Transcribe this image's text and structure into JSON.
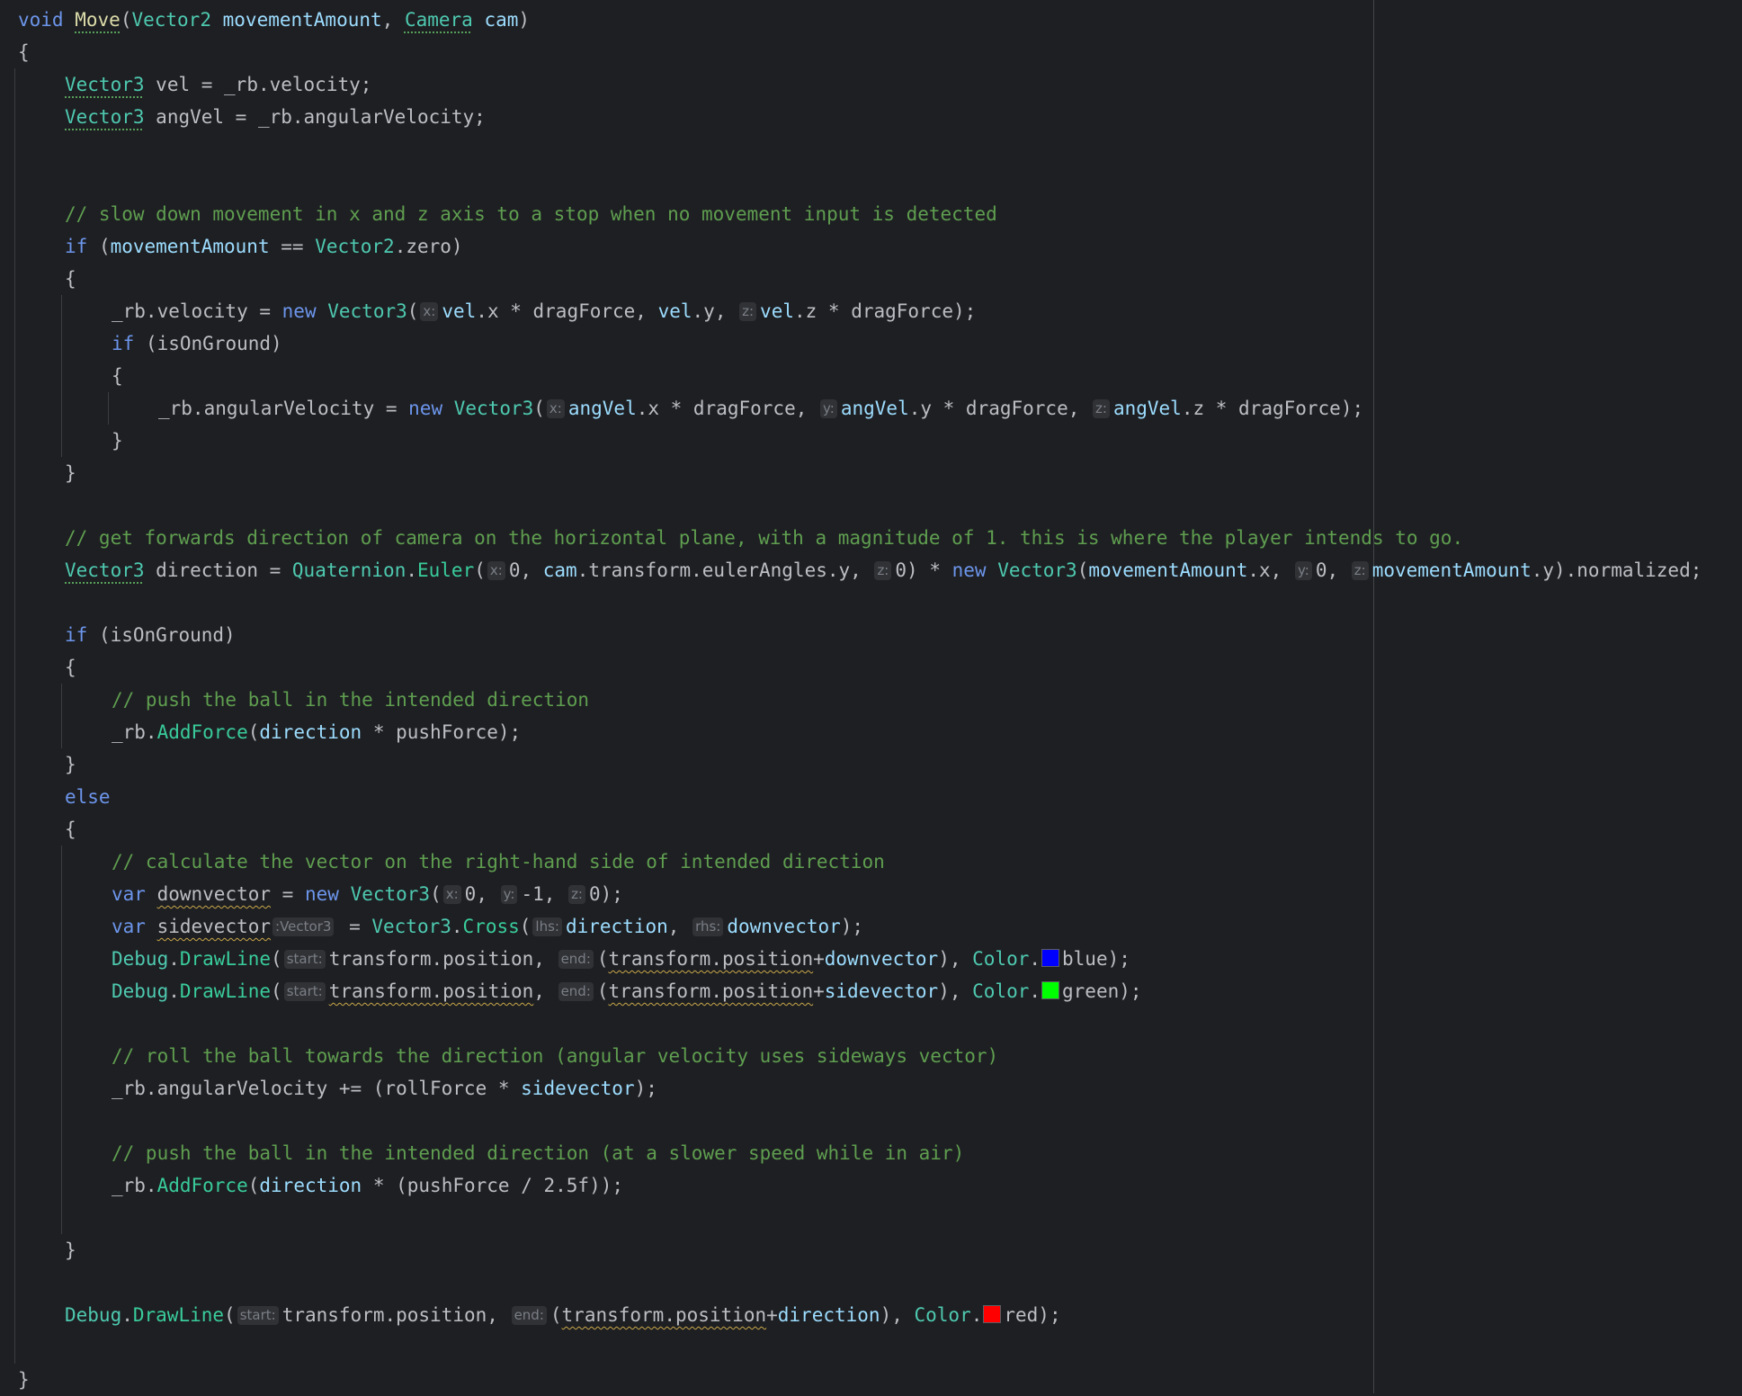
{
  "colors": {
    "background": "#1e1f22",
    "keyword": "#6c95eb",
    "type": "#4ec9b0",
    "method": "#39cc9b",
    "parameter": "#9cdcfe",
    "comment": "#5f9e50",
    "text": "#bcbec4",
    "swatch_blue": "#0000ff",
    "swatch_green": "#00ff00",
    "swatch_red": "#ff0000"
  },
  "icons": {
    "color_swatch": "color-swatch-icon"
  },
  "code_lines": [
    {
      "indent": 0,
      "tokens": [
        {
          "k": "kw",
          "t": "void"
        },
        {
          "k": "txt",
          "t": " "
        },
        {
          "k": "fndecl",
          "t": "Move",
          "u": "green"
        },
        {
          "k": "txt",
          "t": "("
        },
        {
          "k": "type",
          "t": "Vector2"
        },
        {
          "k": "txt",
          "t": " "
        },
        {
          "k": "param",
          "t": "movementAmount"
        },
        {
          "k": "txt",
          "t": ", "
        },
        {
          "k": "type",
          "t": "Camera",
          "u": "green"
        },
        {
          "k": "txt",
          "t": " "
        },
        {
          "k": "param",
          "t": "cam"
        },
        {
          "k": "txt",
          "t": ")"
        }
      ]
    },
    {
      "indent": 0,
      "tokens": [
        {
          "k": "txt",
          "t": "{"
        }
      ]
    },
    {
      "indent": 1,
      "tokens": [
        {
          "k": "type",
          "t": "Vector3",
          "u": "green"
        },
        {
          "k": "txt",
          "t": " "
        },
        {
          "k": "local",
          "t": "vel"
        },
        {
          "k": "txt",
          "t": " = _rb.velocity;"
        }
      ]
    },
    {
      "indent": 1,
      "tokens": [
        {
          "k": "type",
          "t": "Vector3",
          "u": "green"
        },
        {
          "k": "txt",
          "t": " "
        },
        {
          "k": "local",
          "t": "angVel"
        },
        {
          "k": "txt",
          "t": " = _rb.angularVelocity;"
        }
      ]
    },
    {
      "indent": 0,
      "tokens": []
    },
    {
      "indent": 0,
      "tokens": []
    },
    {
      "indent": 1,
      "tokens": [
        {
          "k": "com",
          "t": "// slow down movement in x and z axis to a stop when no movement input is detected"
        }
      ]
    },
    {
      "indent": 1,
      "tokens": [
        {
          "k": "kw",
          "t": "if"
        },
        {
          "k": "txt",
          "t": " ("
        },
        {
          "k": "param",
          "t": "movementAmount"
        },
        {
          "k": "txt",
          "t": " == "
        },
        {
          "k": "type",
          "t": "Vector2"
        },
        {
          "k": "txt",
          "t": ".zero)"
        }
      ]
    },
    {
      "indent": 1,
      "tokens": [
        {
          "k": "txt",
          "t": "{"
        }
      ]
    },
    {
      "indent": 2,
      "tokens": [
        {
          "k": "txt",
          "t": "_rb.velocity = "
        },
        {
          "k": "kw",
          "t": "new"
        },
        {
          "k": "txt",
          "t": " "
        },
        {
          "k": "type",
          "t": "Vector3"
        },
        {
          "k": "txt",
          "t": "("
        },
        {
          "k": "hint",
          "t": "x:"
        },
        {
          "k": "var",
          "t": "vel"
        },
        {
          "k": "txt",
          "t": ".x * dragForce, "
        },
        {
          "k": "var",
          "t": "vel"
        },
        {
          "k": "txt",
          "t": ".y, "
        },
        {
          "k": "hint",
          "t": "z:"
        },
        {
          "k": "var",
          "t": "vel"
        },
        {
          "k": "txt",
          "t": ".z * dragForce);"
        }
      ]
    },
    {
      "indent": 2,
      "tokens": [
        {
          "k": "kw",
          "t": "if"
        },
        {
          "k": "txt",
          "t": " (isOnGround)"
        }
      ]
    },
    {
      "indent": 2,
      "tokens": [
        {
          "k": "txt",
          "t": "{"
        }
      ]
    },
    {
      "indent": 3,
      "tokens": [
        {
          "k": "txt",
          "t": "_rb.angularVelocity = "
        },
        {
          "k": "kw",
          "t": "new"
        },
        {
          "k": "txt",
          "t": " "
        },
        {
          "k": "type",
          "t": "Vector3"
        },
        {
          "k": "txt",
          "t": "("
        },
        {
          "k": "hint",
          "t": "x:"
        },
        {
          "k": "var",
          "t": "angVel"
        },
        {
          "k": "txt",
          "t": ".x * dragForce, "
        },
        {
          "k": "hint",
          "t": "y:"
        },
        {
          "k": "var",
          "t": "angVel"
        },
        {
          "k": "txt",
          "t": ".y * dragForce, "
        },
        {
          "k": "hint",
          "t": "z:"
        },
        {
          "k": "var",
          "t": "angVel"
        },
        {
          "k": "txt",
          "t": ".z * dragForce);"
        }
      ]
    },
    {
      "indent": 2,
      "tokens": [
        {
          "k": "txt",
          "t": "}"
        }
      ]
    },
    {
      "indent": 1,
      "tokens": [
        {
          "k": "txt",
          "t": "}"
        }
      ]
    },
    {
      "indent": 0,
      "tokens": []
    },
    {
      "indent": 1,
      "tokens": [
        {
          "k": "com",
          "t": "// get forwards direction of camera on the horizontal plane, with a magnitude of 1. this is where the player intends to go."
        }
      ]
    },
    {
      "indent": 1,
      "tokens": [
        {
          "k": "type",
          "t": "Vector3",
          "u": "green"
        },
        {
          "k": "txt",
          "t": " "
        },
        {
          "k": "local",
          "t": "direction"
        },
        {
          "k": "txt",
          "t": " = "
        },
        {
          "k": "type",
          "t": "Quaternion"
        },
        {
          "k": "txt",
          "t": "."
        },
        {
          "k": "fn",
          "t": "Euler"
        },
        {
          "k": "txt",
          "t": "("
        },
        {
          "k": "hint",
          "t": "x:"
        },
        {
          "k": "num",
          "t": "0"
        },
        {
          "k": "txt",
          "t": ", "
        },
        {
          "k": "param",
          "t": "cam"
        },
        {
          "k": "txt",
          "t": ".transform.eulerAngles.y, "
        },
        {
          "k": "hint",
          "t": "z:"
        },
        {
          "k": "num",
          "t": "0"
        },
        {
          "k": "txt",
          "t": ") * "
        },
        {
          "k": "kw",
          "t": "new"
        },
        {
          "k": "txt",
          "t": " "
        },
        {
          "k": "type",
          "t": "Vector3"
        },
        {
          "k": "txt",
          "t": "("
        },
        {
          "k": "param",
          "t": "movementAmount"
        },
        {
          "k": "txt",
          "t": ".x, "
        },
        {
          "k": "hint",
          "t": "y:"
        },
        {
          "k": "num",
          "t": "0"
        },
        {
          "k": "txt",
          "t": ", "
        },
        {
          "k": "hint",
          "t": "z:"
        },
        {
          "k": "param",
          "t": "movementAmount"
        },
        {
          "k": "txt",
          "t": ".y).normalized;"
        }
      ]
    },
    {
      "indent": 0,
      "tokens": []
    },
    {
      "indent": 1,
      "tokens": [
        {
          "k": "kw",
          "t": "if"
        },
        {
          "k": "txt",
          "t": " (isOnGround)"
        }
      ]
    },
    {
      "indent": 1,
      "tokens": [
        {
          "k": "txt",
          "t": "{"
        }
      ]
    },
    {
      "indent": 2,
      "tokens": [
        {
          "k": "com",
          "t": "// push the ball in the intended direction"
        }
      ]
    },
    {
      "indent": 2,
      "tokens": [
        {
          "k": "txt",
          "t": "_rb."
        },
        {
          "k": "fn",
          "t": "AddForce"
        },
        {
          "k": "txt",
          "t": "("
        },
        {
          "k": "var",
          "t": "direction"
        },
        {
          "k": "txt",
          "t": " * pushForce);"
        }
      ]
    },
    {
      "indent": 1,
      "tokens": [
        {
          "k": "txt",
          "t": "}"
        }
      ]
    },
    {
      "indent": 1,
      "tokens": [
        {
          "k": "kw",
          "t": "else"
        }
      ]
    },
    {
      "indent": 1,
      "tokens": [
        {
          "k": "txt",
          "t": "{"
        }
      ]
    },
    {
      "indent": 2,
      "tokens": [
        {
          "k": "com",
          "t": "// calculate the vector on the right-hand side of intended direction"
        }
      ]
    },
    {
      "indent": 2,
      "tokens": [
        {
          "k": "kw",
          "t": "var"
        },
        {
          "k": "txt",
          "t": " "
        },
        {
          "k": "local",
          "t": "downvector",
          "u": "wavy"
        },
        {
          "k": "txt",
          "t": " = "
        },
        {
          "k": "kw",
          "t": "new"
        },
        {
          "k": "txt",
          "t": " "
        },
        {
          "k": "type",
          "t": "Vector3"
        },
        {
          "k": "txt",
          "t": "("
        },
        {
          "k": "hint",
          "t": "x:"
        },
        {
          "k": "num",
          "t": "0"
        },
        {
          "k": "txt",
          "t": ", "
        },
        {
          "k": "hint",
          "t": "y:"
        },
        {
          "k": "num",
          "t": "-1"
        },
        {
          "k": "txt",
          "t": ", "
        },
        {
          "k": "hint",
          "t": "z:"
        },
        {
          "k": "num",
          "t": "0"
        },
        {
          "k": "txt",
          "t": ");"
        }
      ]
    },
    {
      "indent": 2,
      "tokens": [
        {
          "k": "kw",
          "t": "var"
        },
        {
          "k": "txt",
          "t": " "
        },
        {
          "k": "local",
          "t": "sidevector",
          "u": "wavy"
        },
        {
          "k": "hint",
          "t": ":Vector3"
        },
        {
          "k": "txt",
          "t": " = "
        },
        {
          "k": "type",
          "t": "Vector3"
        },
        {
          "k": "txt",
          "t": "."
        },
        {
          "k": "fn",
          "t": "Cross"
        },
        {
          "k": "txt",
          "t": "("
        },
        {
          "k": "hint",
          "t": "lhs:"
        },
        {
          "k": "var",
          "t": "direction"
        },
        {
          "k": "txt",
          "t": ", "
        },
        {
          "k": "hint",
          "t": "rhs:"
        },
        {
          "k": "var",
          "t": "downvector"
        },
        {
          "k": "txt",
          "t": ");"
        }
      ]
    },
    {
      "indent": 2,
      "tokens": [
        {
          "k": "type",
          "t": "Debug"
        },
        {
          "k": "txt",
          "t": "."
        },
        {
          "k": "fn",
          "t": "DrawLine"
        },
        {
          "k": "txt",
          "t": "("
        },
        {
          "k": "hint",
          "t": "start:"
        },
        {
          "k": "txt",
          "t": "transform.position, "
        },
        {
          "k": "hint",
          "t": "end:"
        },
        {
          "k": "txt",
          "t": "("
        },
        {
          "k": "txt",
          "t": "transform.position",
          "u": "wavy"
        },
        {
          "k": "txt",
          "t": "+"
        },
        {
          "k": "var",
          "t": "downvector"
        },
        {
          "k": "txt",
          "t": "), "
        },
        {
          "k": "type",
          "t": "Color"
        },
        {
          "k": "txt",
          "t": "."
        },
        {
          "k": "swatch",
          "t": "#0000ff"
        },
        {
          "k": "txt",
          "t": "blue);"
        }
      ]
    },
    {
      "indent": 2,
      "tokens": [
        {
          "k": "type",
          "t": "Debug"
        },
        {
          "k": "txt",
          "t": "."
        },
        {
          "k": "fn",
          "t": "DrawLine"
        },
        {
          "k": "txt",
          "t": "("
        },
        {
          "k": "hint",
          "t": "start:"
        },
        {
          "k": "txt",
          "t": "transform.position",
          "u": "wavy"
        },
        {
          "k": "txt",
          "t": ", "
        },
        {
          "k": "hint",
          "t": "end:"
        },
        {
          "k": "txt",
          "t": "("
        },
        {
          "k": "txt",
          "t": "transform.position",
          "u": "wavy"
        },
        {
          "k": "txt",
          "t": "+"
        },
        {
          "k": "var",
          "t": "sidevector"
        },
        {
          "k": "txt",
          "t": "), "
        },
        {
          "k": "type",
          "t": "Color"
        },
        {
          "k": "txt",
          "t": "."
        },
        {
          "k": "swatch",
          "t": "#00ff00"
        },
        {
          "k": "txt",
          "t": "green);"
        }
      ]
    },
    {
      "indent": 0,
      "tokens": []
    },
    {
      "indent": 2,
      "tokens": [
        {
          "k": "com",
          "t": "// roll the ball towards the direction (angular velocity uses sideways vector)"
        }
      ]
    },
    {
      "indent": 2,
      "tokens": [
        {
          "k": "txt",
          "t": "_rb.angularVelocity += (rollForce * "
        },
        {
          "k": "var",
          "t": "sidevector"
        },
        {
          "k": "txt",
          "t": ");"
        }
      ]
    },
    {
      "indent": 0,
      "tokens": []
    },
    {
      "indent": 2,
      "tokens": [
        {
          "k": "com",
          "t": "// push the ball in the intended direction (at a slower speed while in air)"
        }
      ]
    },
    {
      "indent": 2,
      "tokens": [
        {
          "k": "txt",
          "t": "_rb."
        },
        {
          "k": "fn",
          "t": "AddForce"
        },
        {
          "k": "txt",
          "t": "("
        },
        {
          "k": "var",
          "t": "direction"
        },
        {
          "k": "txt",
          "t": " * (pushForce / "
        },
        {
          "k": "num",
          "t": "2.5f"
        },
        {
          "k": "txt",
          "t": "));"
        }
      ]
    },
    {
      "indent": 0,
      "tokens": []
    },
    {
      "indent": 1,
      "tokens": [
        {
          "k": "txt",
          "t": "}"
        }
      ]
    },
    {
      "indent": 0,
      "tokens": []
    },
    {
      "indent": 1,
      "tokens": [
        {
          "k": "type",
          "t": "Debug"
        },
        {
          "k": "txt",
          "t": "."
        },
        {
          "k": "fn",
          "t": "DrawLine"
        },
        {
          "k": "txt",
          "t": "("
        },
        {
          "k": "hint",
          "t": "start:"
        },
        {
          "k": "txt",
          "t": "transform.position, "
        },
        {
          "k": "hint",
          "t": "end:"
        },
        {
          "k": "txt",
          "t": "("
        },
        {
          "k": "txt",
          "t": "transform.position",
          "u": "wavy"
        },
        {
          "k": "txt",
          "t": "+"
        },
        {
          "k": "var",
          "t": "direction"
        },
        {
          "k": "txt",
          "t": "), "
        },
        {
          "k": "type",
          "t": "Color"
        },
        {
          "k": "txt",
          "t": "."
        },
        {
          "k": "swatch",
          "t": "#ff0000"
        },
        {
          "k": "txt",
          "t": "red);"
        }
      ]
    },
    {
      "indent": 0,
      "tokens": []
    },
    {
      "indent": 0,
      "tokens": [
        {
          "k": "txt",
          "t": "}"
        }
      ]
    }
  ]
}
